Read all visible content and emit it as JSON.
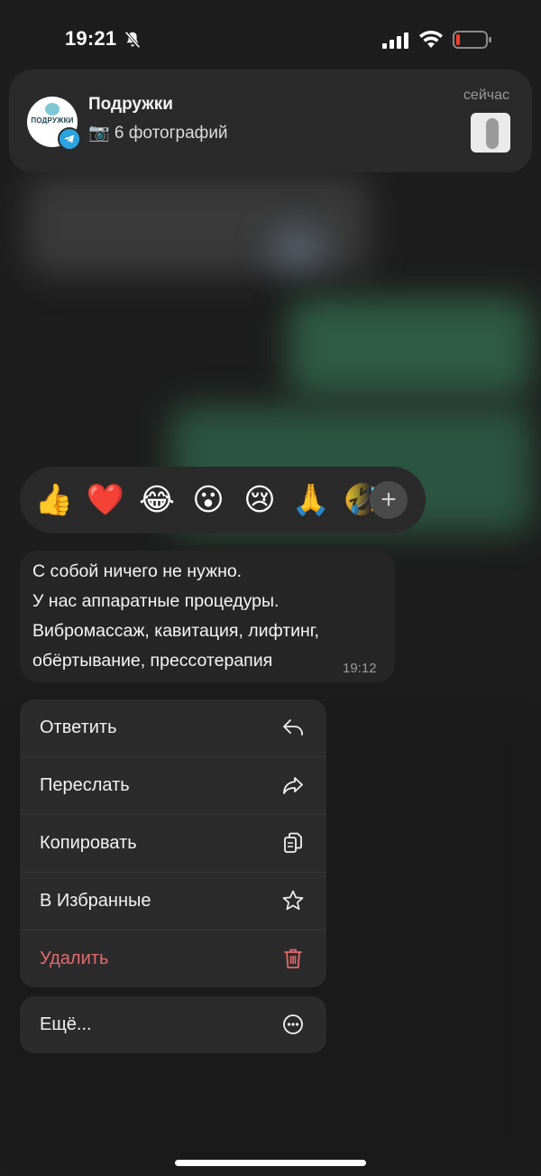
{
  "status_bar": {
    "time": "19:21",
    "icons": [
      "bell-slash-icon",
      "cellular-signal-icon",
      "wifi-icon",
      "battery-low-icon"
    ]
  },
  "notification": {
    "title": "Подружки",
    "body": "📷 6 фотографий",
    "time": "сейчас",
    "avatar_text": "ПОДРУЖКИ",
    "app_badge": "telegram-icon"
  },
  "reactions": {
    "items": [
      "👍",
      "❤️",
      "😂",
      "😮",
      "😢",
      "🙏",
      "🤣"
    ],
    "more_label": "+"
  },
  "message": {
    "lines": [
      "С собой ничего не нужно.",
      "У нас аппаратные процедуры.",
      "Вибромассаж, кавитация, лифтинг,",
      "обёртывание, прессотерапия"
    ],
    "time": "19:12"
  },
  "menu": {
    "items": [
      {
        "label": "Ответить",
        "icon": "reply-icon"
      },
      {
        "label": "Переслать",
        "icon": "forward-icon"
      },
      {
        "label": "Копировать",
        "icon": "copy-icon"
      },
      {
        "label": "В Избранные",
        "icon": "star-icon"
      },
      {
        "label": "Удалить",
        "icon": "trash-icon"
      }
    ],
    "more": {
      "label": "Ещё...",
      "icon": "more-icon"
    }
  },
  "colors": {
    "background": "#1d1d1d",
    "panel": "#2b2b2b",
    "danger": "#e26a6e",
    "telegram": "#2aa3df"
  }
}
